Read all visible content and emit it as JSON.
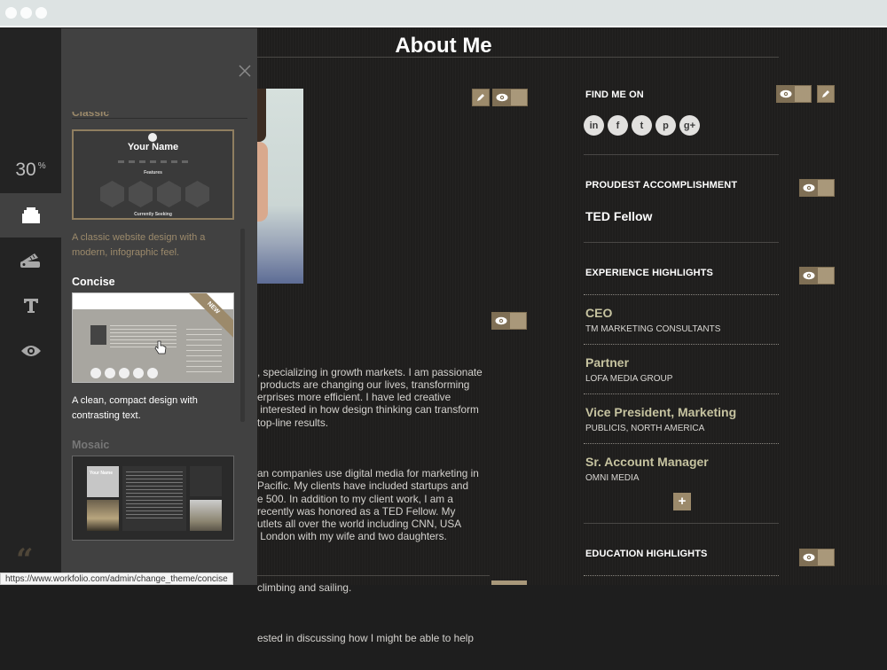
{
  "window": {
    "traffic_lights": 3
  },
  "status_url": "https://www.workfolio.com/admin/change_theme/concise",
  "iconbar": {
    "zoom_value": "30",
    "zoom_unit": "%",
    "items": [
      {
        "icon": "theme-stack-icon",
        "active": true
      },
      {
        "icon": "color-swatch-icon",
        "active": false
      },
      {
        "icon": "typography-icon",
        "active": false
      },
      {
        "icon": "eye-icon",
        "active": false
      }
    ],
    "logo": "workfolio-logo"
  },
  "theme_panel": {
    "close_icon": "close-icon",
    "previous_heading_partial": "Classic",
    "themes": [
      {
        "name": "Classic",
        "selected": true,
        "description": "A classic website design with a\nmodern, infographic feel.",
        "thumb": {
          "title": "Your Name",
          "section": "Features",
          "footer": "Currently Seeking"
        }
      },
      {
        "name": "Concise",
        "selected": false,
        "hovered": true,
        "badge": "NEW",
        "description": "A clean, compact design with\ncontrasting text."
      },
      {
        "name": "Mosaic",
        "selected": false,
        "thumb": {
          "title": "Your Name"
        }
      }
    ]
  },
  "main": {
    "title": "About Me",
    "bio_paragraphs": [
      ", specializing in growth markets. I am passionate\n products are changing our lives, transforming\nerprises more efficient. I have led creative\n interested in how design thinking can transform\ntop-line results.",
      "an companies use digital media for marketing in\nPacific. My clients have included startups and\ne 500. In addition to my client work, I am a\nrecently was honored as a TED Fellow. My\nutlets all over the world including CNN, USA\n London with my wife and two daughters.",
      "climbing and sailing.",
      "ested in discussing how I might be able to help"
    ]
  },
  "sidebar": {
    "find_me_on": {
      "title": "FIND ME ON",
      "networks": [
        {
          "name": "linkedin",
          "glyph": "in"
        },
        {
          "name": "facebook",
          "glyph": "f"
        },
        {
          "name": "twitter",
          "glyph": "t"
        },
        {
          "name": "pinterest",
          "glyph": "p"
        },
        {
          "name": "google-plus",
          "glyph": "g+"
        }
      ]
    },
    "proudest": {
      "title": "PROUDEST ACCOMPLISHMENT",
      "value": "TED Fellow"
    },
    "experience": {
      "title": "EXPERIENCE HIGHLIGHTS",
      "items": [
        {
          "role": "CEO",
          "company": "TM MARKETING CONSULTANTS"
        },
        {
          "role": "Partner",
          "company": "LOFA MEDIA GROUP"
        },
        {
          "role": "Vice President, Marketing",
          "company": "PUBLICIS, NORTH AMERICA"
        },
        {
          "role": "Sr. Account Manager",
          "company": "OMNI MEDIA"
        }
      ],
      "add_label": "+"
    },
    "education": {
      "title": "EDUCATION HIGHLIGHTS"
    }
  },
  "colors": {
    "accent": "#9c8a6b",
    "job_title": "#c6c3a0",
    "panel_bg": "#414141",
    "iconbar_bg": "#232323"
  }
}
